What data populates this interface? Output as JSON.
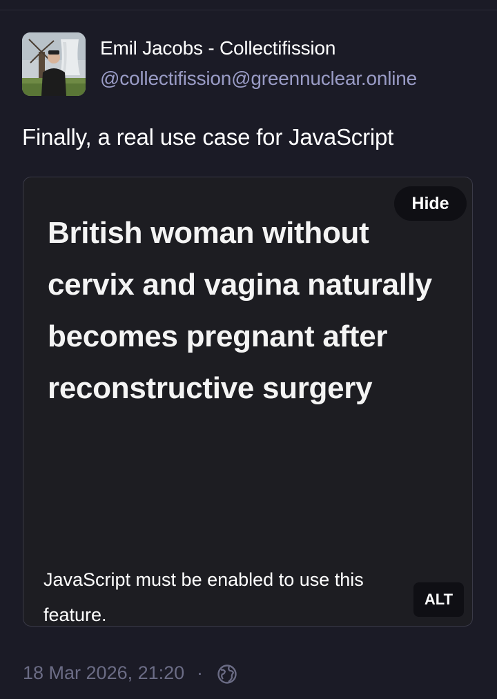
{
  "author": {
    "display_name": "Emil Jacobs - Collectifission",
    "handle": "@collectifission@greennuclear.online"
  },
  "post": {
    "text": "Finally, a real use case for JavaScript",
    "timestamp": "18 Mar 2026, 21:20",
    "separator": "·",
    "visibility_icon": "globe-icon"
  },
  "media": {
    "headline": "British woman without cervix and vagina naturally becomes pregnant after reconstructive surgery",
    "hide_label": "Hide",
    "notice": "JavaScript must be enabled to use this feature.",
    "alt_label": "ALT"
  },
  "colors": {
    "background": "#1b1b26",
    "handle": "#9a9cc6",
    "muted": "#6b6c85",
    "card": "#1d1d22"
  }
}
